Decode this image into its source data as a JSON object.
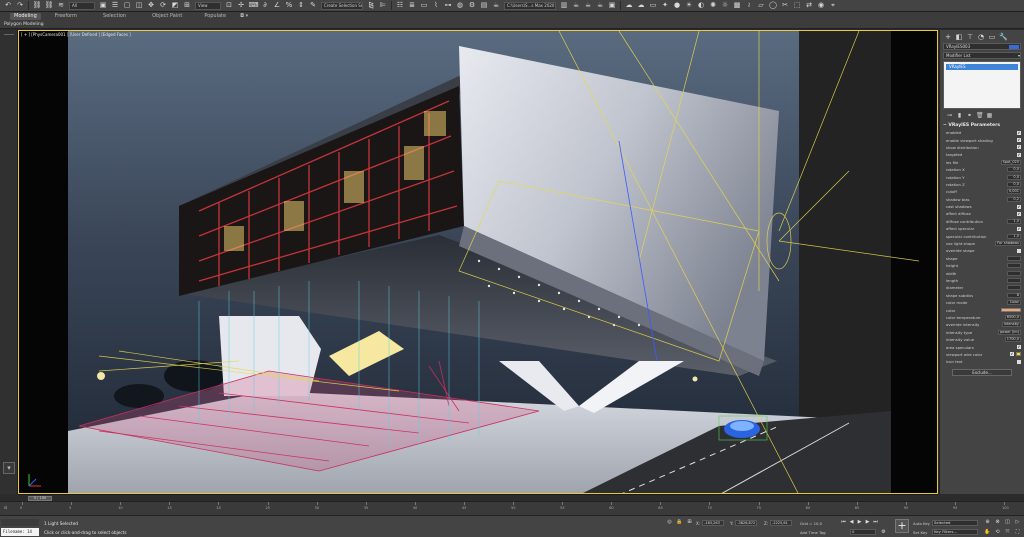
{
  "toolbar": {
    "undo_icon": "undo-icon",
    "redo_icon": "redo-icon",
    "selection_filter": "All",
    "reference_coord": "View",
    "selection_set": "Create Selection Se",
    "workspace": "C:\\Users\\S...s Max 2020"
  },
  "ribbon": {
    "tabs": [
      "Modeling",
      "Freeform",
      "Selection",
      "Object Paint",
      "Populate"
    ],
    "active_tab": "Modeling",
    "sub_label": "Polygon Modeling"
  },
  "viewport": {
    "label": "[ + ] [PhysCamera001 ] [User Defined ] [Edged Faces ]",
    "frame_color": "#e8c840"
  },
  "command_panel": {
    "object_name": "VRayIES003",
    "object_color": "#3a6ad8",
    "modifier_list": "Modifier List",
    "stack_item": "VRayIES",
    "rollout_title": "VRayIES Parameters",
    "params": [
      {
        "label": "enabled",
        "kind": "check",
        "value": "✔"
      },
      {
        "label": "enable viewport shading",
        "kind": "check",
        "value": "✔"
      },
      {
        "label": "show distribution",
        "kind": "check",
        "value": "✔"
      },
      {
        "label": "targeted",
        "kind": "check",
        "value": "✔"
      },
      {
        "label": "ies file",
        "kind": "field",
        "value": "Spot_025"
      },
      {
        "label": "rotation X",
        "kind": "field",
        "value": "0,0"
      },
      {
        "label": "rotation Y",
        "kind": "field",
        "value": "0,0"
      },
      {
        "label": "rotation Z",
        "kind": "field",
        "value": "0,0"
      },
      {
        "label": "cutoff",
        "kind": "field",
        "value": "0,001"
      },
      {
        "label": "shadow bias",
        "kind": "field",
        "value": "0,2"
      },
      {
        "label": "cast shadows",
        "kind": "check",
        "value": "✔"
      },
      {
        "label": "affect diffuse",
        "kind": "check",
        "value": "✔"
      },
      {
        "label": "diffuse contribution",
        "kind": "field",
        "value": "1,0"
      },
      {
        "label": "affect specular",
        "kind": "check",
        "value": "✔"
      },
      {
        "label": "specular contribution",
        "kind": "field",
        "value": "1,0"
      },
      {
        "label": "use light shape",
        "kind": "field",
        "value": "For shadows"
      },
      {
        "label": "override shape",
        "kind": "check",
        "value": ""
      },
      {
        "label": "shape",
        "kind": "field",
        "value": ""
      },
      {
        "label": "height",
        "kind": "field",
        "value": ""
      },
      {
        "label": "width",
        "kind": "field",
        "value": ""
      },
      {
        "label": "length",
        "kind": "field",
        "value": ""
      },
      {
        "label": "diameter",
        "kind": "field",
        "value": ""
      },
      {
        "label": "shape subdivs",
        "kind": "field",
        "value": "8"
      },
      {
        "label": "color mode",
        "kind": "field",
        "value": "Color"
      },
      {
        "label": "color",
        "kind": "color",
        "value": ""
      },
      {
        "label": "color temperature",
        "kind": "field",
        "value": "6500,0"
      },
      {
        "label": "override intensity",
        "kind": "field",
        "value": "Intensity"
      },
      {
        "label": "intensity type",
        "kind": "field",
        "value": "power (lm)"
      },
      {
        "label": "intensity value",
        "kind": "field",
        "value": "1700,0"
      },
      {
        "label": "area speculars",
        "kind": "check",
        "value": "✔"
      },
      {
        "label": "viewport wire color",
        "kind": "color2",
        "value": "✔"
      },
      {
        "label": "icon text",
        "kind": "check",
        "value": ""
      }
    ],
    "exclude_button": "Exclude..."
  },
  "timeline": {
    "slider_label": "0 / 100",
    "ticks": [
      "0",
      "5",
      "10",
      "15",
      "20",
      "25",
      "30",
      "35",
      "40",
      "45",
      "50",
      "55",
      "60",
      "65",
      "70",
      "75",
      "80",
      "85",
      "90",
      "95",
      "100"
    ]
  },
  "status": {
    "maxscript": "Filename: 14",
    "selection": "1 Light Selected",
    "prompt": "Click or click-and-drag to select objects",
    "x_label": "X:",
    "x_value": "-163,263",
    "y_label": "Y:",
    "y_value": "-3826,872",
    "z_label": "Z:",
    "z_value": "-2225,61",
    "grid": "Grid = 10,0",
    "add_time_tag": "Add Time Tag",
    "frame": "0",
    "auto_key": "Auto Key",
    "set_key": "Set Key",
    "selected": "Selected",
    "key_filters": "Key Filters..."
  }
}
